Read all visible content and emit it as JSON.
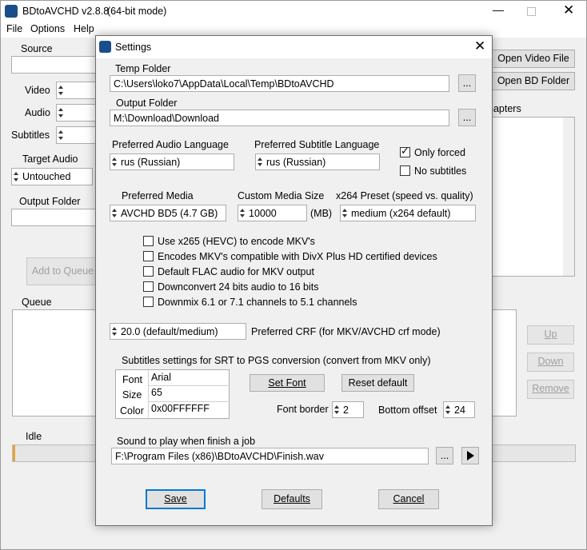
{
  "app": {
    "title": "BDtoAVCHD v2.8.8",
    "subtitle": "(64-bit mode)",
    "menu": [
      "File",
      "Options",
      "Help"
    ],
    "source_label": "Source",
    "video_label": "Video",
    "audio_label": "Audio",
    "subtitles_label": "Subtitles",
    "target_audio_label": "Target Audio",
    "target_audio_value": "Untouched",
    "output_folder_label": "Output Folder",
    "add_to_queue": "Add to Queue",
    "queue_label": "Queue",
    "open_video_file": "Open Video File",
    "open_bd_folder": "Open BD Folder",
    "chapters_label": "Chapters",
    "up": "Up",
    "down": "Down",
    "remove": "Remove",
    "status": "Idle"
  },
  "dialog": {
    "title": "Settings",
    "temp_folder_label": "Temp Folder",
    "temp_folder_value": "C:\\Users\\loko7\\AppData\\Local\\Temp\\BDtoAVCHD",
    "output_folder_label": "Output Folder",
    "output_folder_value": "M:\\Download\\Download",
    "browse": "...",
    "pref_audio_lang_label": "Preferred Audio Language",
    "pref_audio_lang_value": "rus (Russian)",
    "pref_sub_lang_label": "Preferred Subtitle Language",
    "pref_sub_lang_value": "rus (Russian)",
    "only_forced": "Only forced",
    "only_forced_checked": true,
    "no_subtitles": "No subtitles",
    "no_subtitles_checked": false,
    "pref_media_label": "Preferred Media",
    "pref_media_value": "AVCHD BD5 (4.7 GB)",
    "custom_size_label": "Custom Media Size",
    "custom_size_value": "10000",
    "custom_size_unit": "(MB)",
    "x264_label": "x264 Preset (speed vs. quality)",
    "x264_value": "medium (x264 default)",
    "options": [
      {
        "label": "Use x265 (HEVC) to encode MKV's",
        "checked": false
      },
      {
        "label": "Encodes MKV's compatible with DivX Plus HD certified devices",
        "checked": false
      },
      {
        "label": "Default FLAC audio for MKV output",
        "checked": false
      },
      {
        "label": "Downconvert 24 bits audio to 16 bits",
        "checked": false
      },
      {
        "label": "Downmix 6.1 or 7.1 channels to 5.1 channels",
        "checked": false
      }
    ],
    "crf_value": "20.0 (default/medium)",
    "crf_label": "Preferred CRF (for MKV/AVCHD crf mode)",
    "subs_group_label": "Subtitles settings for SRT to PGS conversion (convert from MKV only)",
    "font_rows": [
      {
        "key": "Font",
        "value": "Arial"
      },
      {
        "key": "Size",
        "value": "65"
      },
      {
        "key": "Color",
        "value": "0x00FFFFFF"
      }
    ],
    "set_font": "Set Font",
    "reset_default": "Reset default",
    "font_border_label": "Font border",
    "font_border_value": "2",
    "bottom_offset_label": "Bottom offset",
    "bottom_offset_value": "24",
    "sound_label": "Sound to play when finish a job",
    "sound_value": "F:\\Program Files (x86)\\BDtoAVCHD\\Finish.wav",
    "save": "Save",
    "defaults": "Defaults",
    "cancel": "Cancel"
  }
}
